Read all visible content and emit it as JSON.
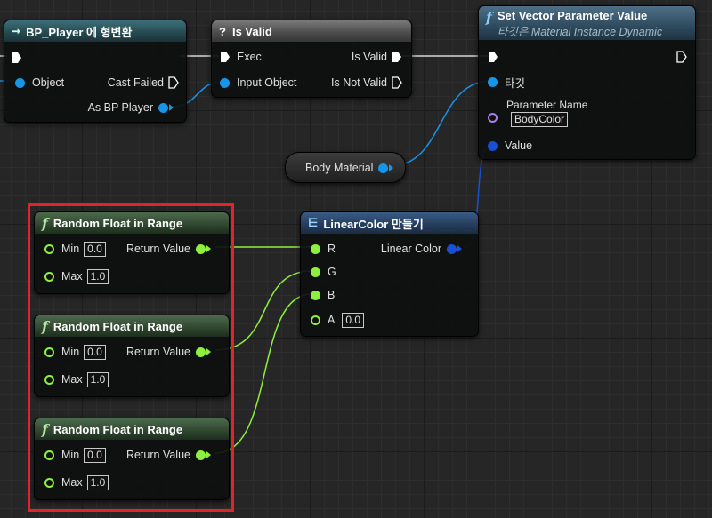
{
  "nodes": {
    "cast": {
      "title": "BP_Player 에 형변환",
      "pin_object": "Object",
      "pin_cast_failed": "Cast Failed",
      "pin_as": "As BP Player"
    },
    "is_valid": {
      "title": "Is Valid",
      "pin_exec": "Exec",
      "pin_input": "Input Object",
      "pin_is_valid": "Is Valid",
      "pin_not_valid": "Is Not Valid"
    },
    "set_vector": {
      "title": "Set Vector Parameter Value",
      "subtitle": "타깃은 Material Instance Dynamic",
      "pin_target": "타깃",
      "pin_param_name": "Parameter Name",
      "param_name_value": "BodyColor",
      "pin_value": "Value"
    },
    "body_material": {
      "label": "Body Material"
    },
    "make_color": {
      "title": "LinearColor 만들기",
      "pin_r": "R",
      "pin_g": "G",
      "pin_b": "B",
      "pin_a": "A",
      "a_value": "0.0",
      "pin_out": "Linear Color"
    },
    "random": [
      {
        "title": "Random Float in Range",
        "pin_min": "Min",
        "min_value": "0.0",
        "pin_max": "Max",
        "max_value": "1.0",
        "pin_return": "Return Value"
      },
      {
        "title": "Random Float in Range",
        "pin_min": "Min",
        "min_value": "0.0",
        "pin_max": "Max",
        "max_value": "1.0",
        "pin_return": "Return Value"
      },
      {
        "title": "Random Float in Range",
        "pin_min": "Min",
        "min_value": "0.0",
        "pin_max": "Max",
        "max_value": "1.0",
        "pin_return": "Return Value"
      }
    ]
  },
  "icons": {
    "cast": "cast-arrow-icon",
    "is_valid": "question-icon",
    "function": "function-f-icon",
    "make": "make-struct-icon"
  },
  "colors": {
    "exec": "#ffffff",
    "object": "#1795e6",
    "struct": "#1b4fd1",
    "float": "#8ef03c",
    "name": "#a87ee8",
    "selection": "#e0242a"
  }
}
